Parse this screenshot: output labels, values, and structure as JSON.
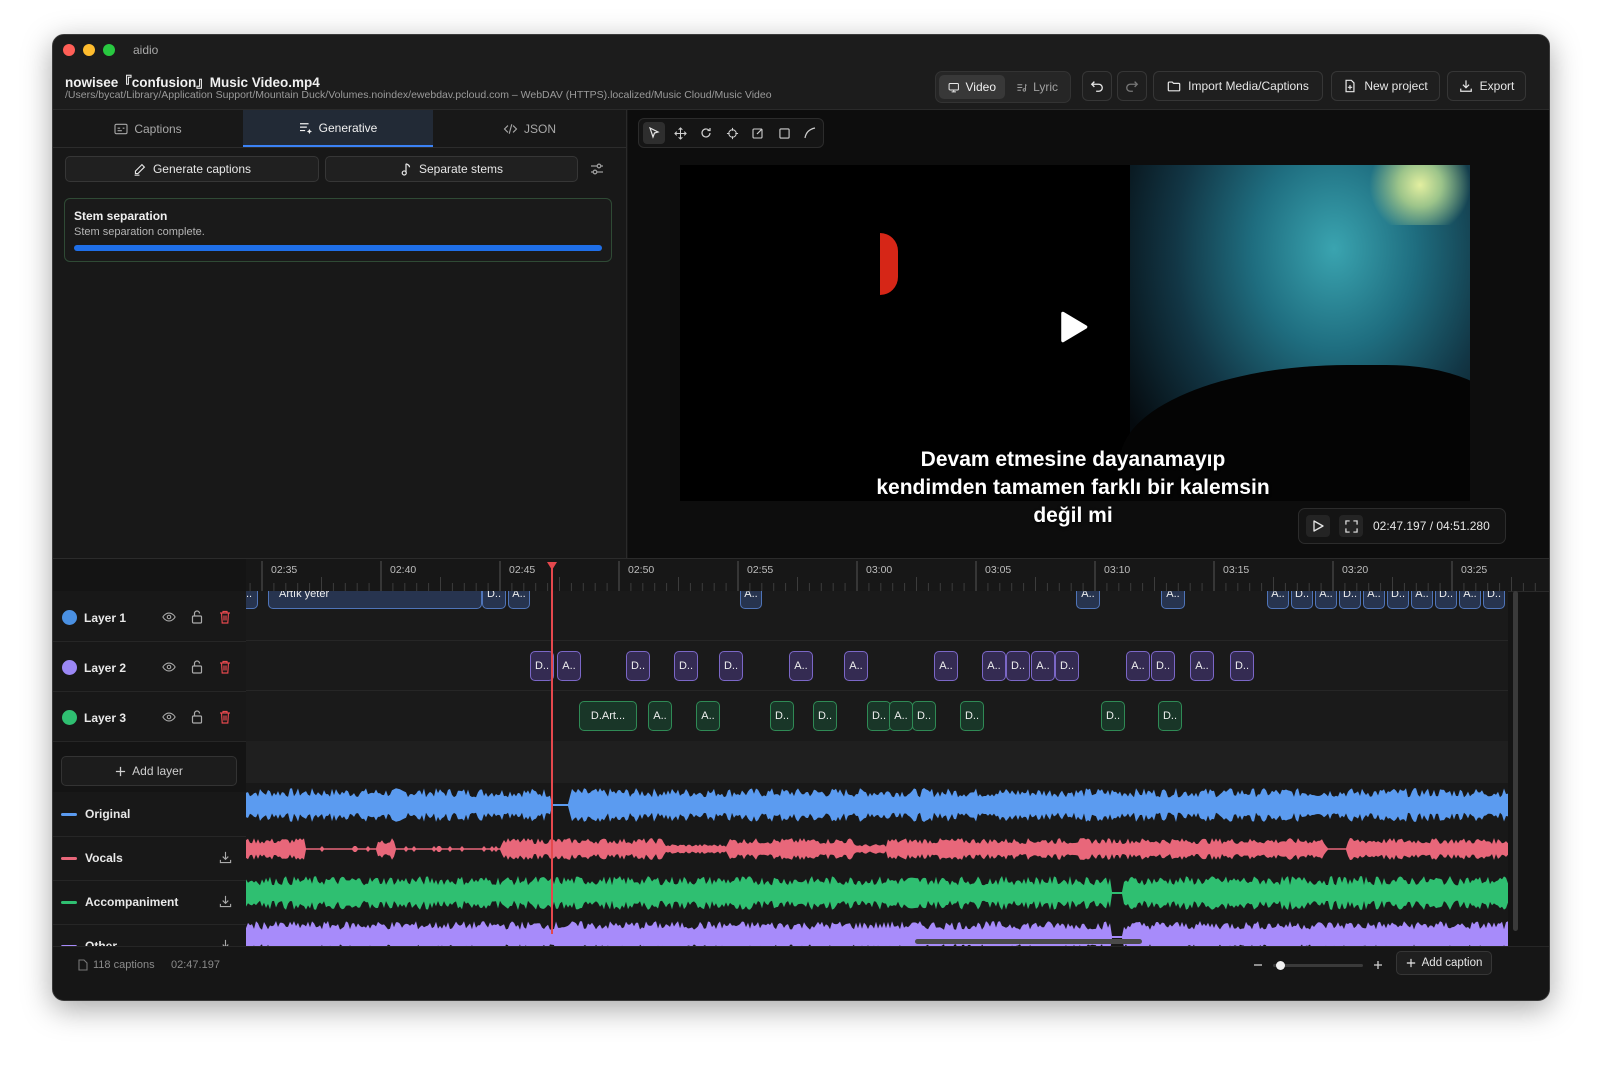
{
  "window": {
    "app_title": "aidio",
    "file_name": "nowisee『confusion』Music Video.mp4",
    "file_path": "/Users/bycat/Library/Application Support/Mountain Duck/Volumes.noindex/ewebdav.pcloud.com – WebDAV (HTTPS).localized/Music Cloud/Music Video"
  },
  "header": {
    "mode_video": "Video",
    "mode_lyric": "Lyric",
    "import_label": "Import Media/Captions",
    "new_project_label": "New project",
    "export_label": "Export"
  },
  "left_panel": {
    "tabs": [
      {
        "label": "Captions"
      },
      {
        "label": "Generative"
      },
      {
        "label": "JSON"
      }
    ],
    "generate_captions_label": "Generate captions",
    "separate_stems_label": "Separate stems",
    "stem_card": {
      "title": "Stem separation",
      "message": "Stem separation complete.",
      "progress": 1.0
    }
  },
  "preview": {
    "subtitle_lines": [
      "Devam etmesine dayanamayıp",
      "kendimden tamamen farklı bir kalemsin",
      "değil mi"
    ],
    "time_display": "02:47.197 / 04:51.280"
  },
  "timeline": {
    "ruler_ticks": [
      "02:35",
      "02:40",
      "02:45",
      "02:50",
      "02:55",
      "03:00",
      "03:05",
      "03:10",
      "03:15",
      "03:20",
      "03:25"
    ],
    "layers": [
      {
        "name": "Layer 1",
        "color": "#4a90e2"
      },
      {
        "name": "Layer 2",
        "color": "#9b87f5"
      },
      {
        "name": "Layer 3",
        "color": "#2fbf71"
      }
    ],
    "add_layer_label": "Add layer",
    "layer1_clips": [
      "..",
      "Artık yeter",
      "D..",
      "A..",
      "A..",
      "A..",
      "A..",
      "A..",
      "D..",
      "A..",
      "D..",
      "A..",
      "D..",
      "A..",
      "D..",
      "A..",
      "D.."
    ],
    "layer2_clips": [
      "D..",
      "A..",
      "D..",
      "D..",
      "D..",
      "A..",
      "A..",
      "A..",
      "A..",
      "D..",
      "A..",
      "D..",
      "A..",
      "D..",
      "A..",
      "D.."
    ],
    "layer3_clips": [
      "D.Art...",
      "A..",
      "A..",
      "D..",
      "D..",
      "D..",
      "A..",
      "D..",
      "D..",
      "D..",
      "D.."
    ],
    "stems": [
      {
        "name": "Original",
        "color": "#5b9bf0"
      },
      {
        "name": "Vocals",
        "color": "#e8677a"
      },
      {
        "name": "Accompaniment",
        "color": "#2fbf71"
      },
      {
        "name": "Other",
        "color": "#a78bfa"
      }
    ],
    "playhead_color": "#e5484d"
  },
  "status_bar": {
    "caption_count": "118 captions",
    "current_time": "02:47.197",
    "zoom_level": 0.03,
    "add_caption_label": "Add caption"
  }
}
